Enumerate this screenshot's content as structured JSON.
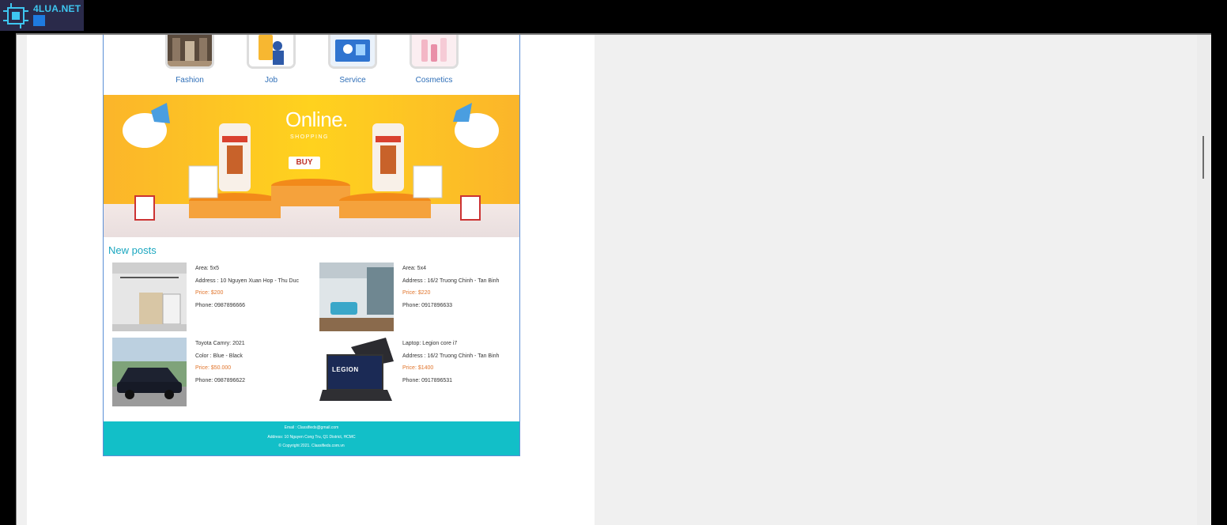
{
  "watermark": {
    "text": "4LUA.NET"
  },
  "categories": [
    {
      "label": "Fashion",
      "icon": "shop-interior-icon"
    },
    {
      "label": "Job",
      "icon": "job-icon"
    },
    {
      "label": "Service",
      "icon": "service-icon"
    },
    {
      "label": "Cosmetics",
      "icon": "cosmetics-icon"
    }
  ],
  "banner": {
    "title": "Online.",
    "subtitle": "SHOPPING",
    "button": "BUY"
  },
  "new_posts": {
    "title": "New posts",
    "items": [
      {
        "line1": "Area: 5x5",
        "line2": "Address : 10 Nguyen Xuan Hop - Thu Duc",
        "price": "Price: $200",
        "phone": "Phone: 0987896666"
      },
      {
        "line1": "Area: 5x4",
        "line2": "Address : 16/2 Truong Chinh - Tan Binh",
        "price": "Price: $220",
        "phone": "Phone: 0917896633"
      },
      {
        "line1": "Toyota Camry: 2021",
        "line2": "Color : Blue - Black",
        "price": "Price: $50.000",
        "phone": "Phone: 0987896622"
      },
      {
        "line1": "Laptop: Legion core i7",
        "line2": "Address : 16/2 Truong Chinh - Tan Binh",
        "price": "Price: $1400",
        "phone": "Phone: 0917896531"
      }
    ]
  },
  "footer": {
    "email": "Email : Classifieds@gmail.com",
    "address": "Address: 10 Nguyen Cong Tru, Q1 District, HCMC",
    "copyright": "© Copyright 2021. Classifieds.com.vn"
  },
  "laptop_brand": "LEGION",
  "colors": {
    "accent": "#12bfc8",
    "price": "#e1752c",
    "link": "#2f6fb8"
  }
}
